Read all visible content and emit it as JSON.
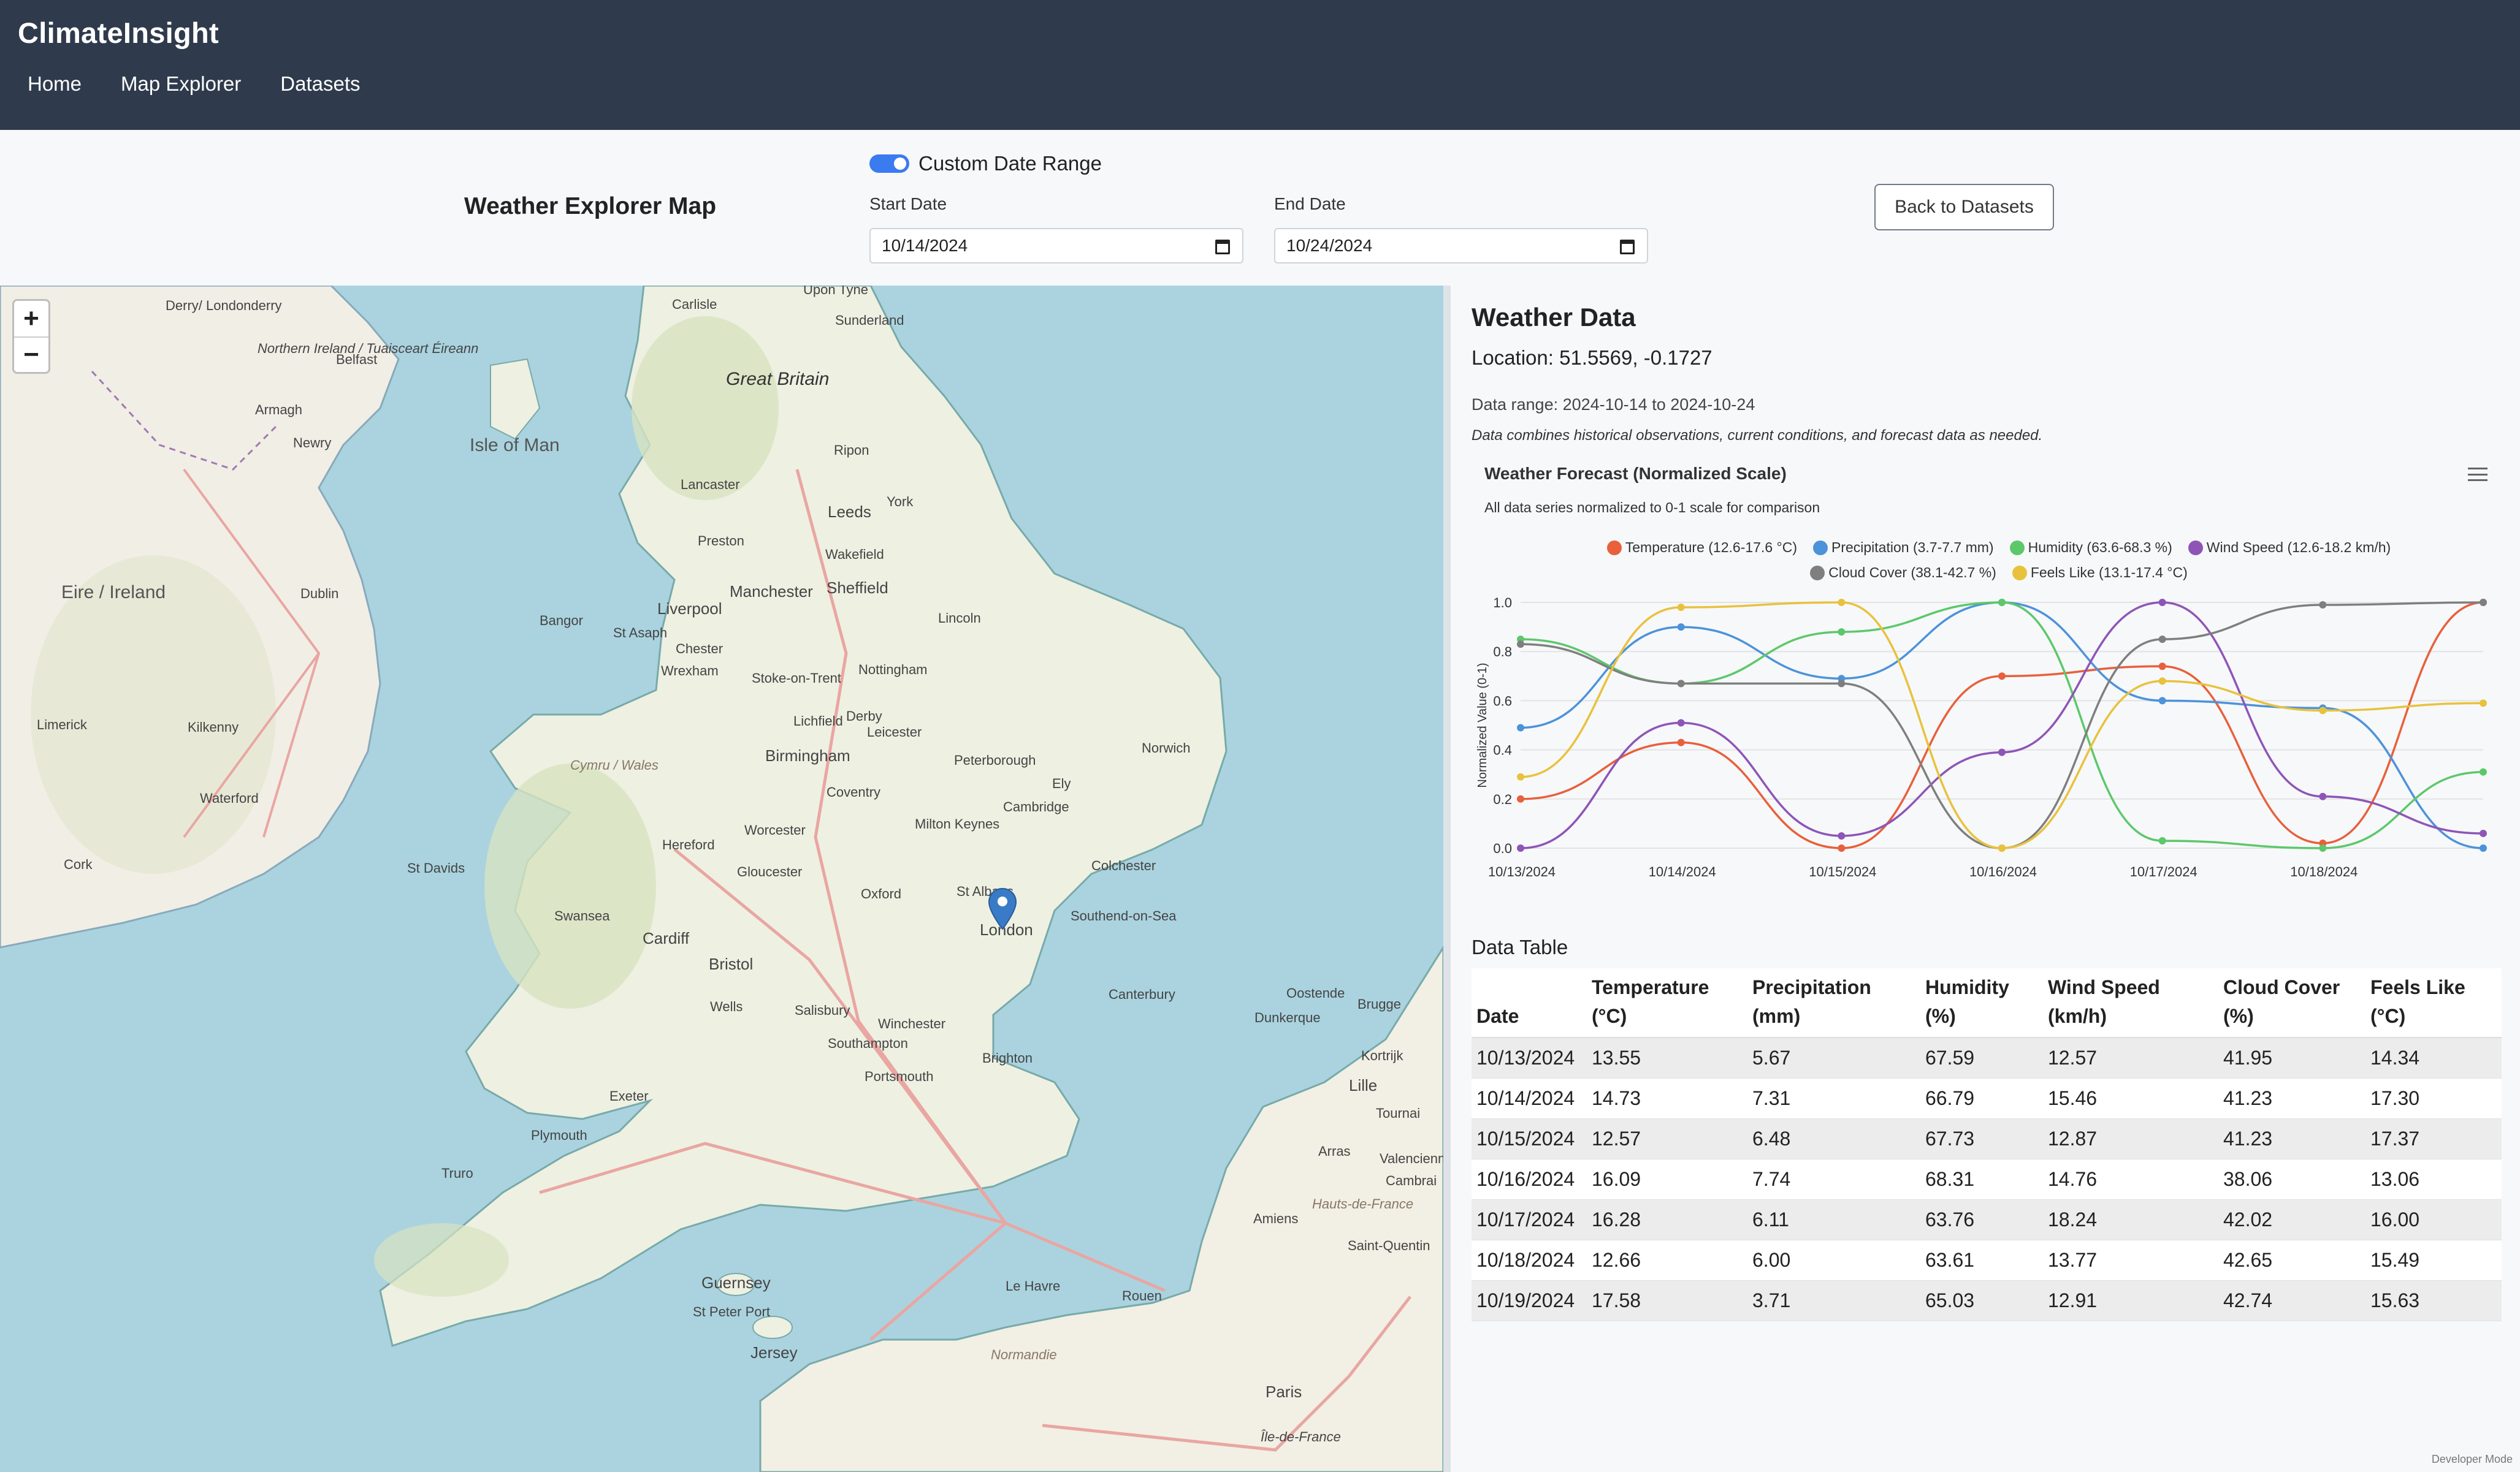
{
  "app": {
    "title": "ClimateInsight"
  },
  "nav": [
    {
      "label": "Home"
    },
    {
      "label": "Map Explorer"
    },
    {
      "label": "Datasets"
    }
  ],
  "toolbar": {
    "page_title": "Weather Explorer Map",
    "toggle_label": "Custom Date Range",
    "toggle_on": true,
    "start_label": "Start Date",
    "start_value": "10/14/2024",
    "end_label": "End Date",
    "end_value": "10/24/2024",
    "back_label": "Back to Datasets"
  },
  "map": {
    "zoom_in": "+",
    "zoom_out": "−",
    "marker_icon": "map-pin-icon",
    "labels": [
      "Great Britain",
      "Isle of Man",
      "Eire / Ireland",
      "Derry/ Londonderry",
      "Northern Ireland / Tuaisceart Éireann",
      "Belfast",
      "Armagh",
      "Newry",
      "Dublin",
      "Limerick",
      "Kilkenny",
      "Waterford",
      "Cork",
      "Carlisle",
      "Upon Tyne",
      "Sunderland",
      "Ripon",
      "York",
      "Leeds",
      "Lancaster",
      "Preston",
      "Wakefield",
      "Sheffield",
      "Manchester",
      "Liverpool",
      "Bangor",
      "St Asaph",
      "Chester",
      "Wrexham",
      "Lincoln",
      "Nottingham",
      "Stoke-on-Trent",
      "Lichfield",
      "Derby",
      "Leicester",
      "Birmingham",
      "Coventry",
      "Peterborough",
      "Norwich",
      "Ely",
      "Cambridge",
      "Worcester",
      "Milton Keynes",
      "Hereford",
      "Gloucester",
      "Oxford",
      "St Albans",
      "Colchester",
      "St Davids",
      "Swansea",
      "Cardiff",
      "Bristol",
      "London",
      "Southend-on-Sea",
      "Wells",
      "Salisbury",
      "Winchester",
      "Canterbury",
      "Southampton",
      "Brighton",
      "Portsmouth",
      "Exeter",
      "Plymouth",
      "Truro",
      "Guernsey",
      "St Peter Port",
      "Jersey",
      "Le Havre",
      "Rouen",
      "Amiens",
      "Arras",
      "Lille",
      "Dunkerque",
      "Oostende",
      "Brugge",
      "Kortrijk",
      "Tournai",
      "Valenciennes",
      "Cambrai",
      "Saint-Quentin",
      "Hauts-de-France",
      "Normandie",
      "Paris",
      "Île-de-France",
      "Cymru / Wales"
    ]
  },
  "panel": {
    "title": "Weather Data",
    "location": "Location: 51.5569, -0.1727",
    "range": "Data range: 2024-10-14 to 2024-10-24",
    "note": "Data combines historical observations, current conditions, and forecast data as needed."
  },
  "chart_menu_icon": "hamburger-menu-icon",
  "chart_data": {
    "type": "line",
    "title": "Weather Forecast (Normalized Scale)",
    "subtitle": "All data series normalized to 0-1 scale for comparison",
    "ylabel": "Normalized Value (0-1)",
    "xlabel": "",
    "ylim": [
      0,
      1
    ],
    "yticks": [
      "0.0",
      "0.2",
      "0.4",
      "0.6",
      "0.8",
      "1.0"
    ],
    "x": [
      "10/13/2024",
      "10/14/2024",
      "10/15/2024",
      "10/16/2024",
      "10/17/2024",
      "10/18/2024",
      "10/19/2024"
    ],
    "xtick_labels": [
      "10/13/2024",
      "10/14/2024",
      "10/15/2024",
      "10/16/2024",
      "10/17/2024",
      "10/18/2024"
    ],
    "grid": true,
    "legend_position": "top",
    "series": [
      {
        "name": "Temperature (12.6-17.6 °C)",
        "color": "#e8603c",
        "values": [
          0.2,
          0.43,
          0.0,
          0.7,
          0.74,
          0.02,
          1.0
        ]
      },
      {
        "name": "Precipitation (3.7-7.7 mm)",
        "color": "#4c93d9",
        "values": [
          0.49,
          0.9,
          0.69,
          1.0,
          0.6,
          0.57,
          0.0
        ]
      },
      {
        "name": "Humidity (63.6-68.3 %)",
        "color": "#5cc86a",
        "values": [
          0.85,
          0.67,
          0.88,
          1.0,
          0.03,
          0.0,
          0.31
        ]
      },
      {
        "name": "Wind Speed (12.6-18.2 km/h)",
        "color": "#8e55b7",
        "values": [
          0.0,
          0.51,
          0.05,
          0.39,
          1.0,
          0.21,
          0.06
        ]
      },
      {
        "name": "Cloud Cover (38.1-42.7 %)",
        "color": "#7f7f7f",
        "values": [
          0.83,
          0.67,
          0.67,
          0.0,
          0.85,
          0.99,
          1.0
        ]
      },
      {
        "name": "Feels Like (13.1-17.4 °C)",
        "color": "#e8c23c",
        "values": [
          0.29,
          0.98,
          1.0,
          0.0,
          0.68,
          0.56,
          0.59
        ]
      }
    ]
  },
  "table": {
    "title": "Data Table",
    "headers": [
      "Date",
      "Temperature (°C)",
      "Precipitation (mm)",
      "Humidity (%)",
      "Wind Speed (km/h)",
      "Cloud Cover (%)",
      "Feels Like (°C)"
    ],
    "header_lines": [
      [
        "Date"
      ],
      [
        "Temperature",
        "(°C)"
      ],
      [
        "Precipitation",
        "(mm)"
      ],
      [
        "Humidity",
        "(%)"
      ],
      [
        "Wind Speed",
        "(km/h)"
      ],
      [
        "Cloud Cover",
        "(%)"
      ],
      [
        "Feels Like",
        "(°C)"
      ]
    ],
    "rows": [
      [
        "10/13/2024",
        "13.55",
        "5.67",
        "67.59",
        "12.57",
        "41.95",
        "14.34"
      ],
      [
        "10/14/2024",
        "14.73",
        "7.31",
        "66.79",
        "15.46",
        "41.23",
        "17.30"
      ],
      [
        "10/15/2024",
        "12.57",
        "6.48",
        "67.73",
        "12.87",
        "41.23",
        "17.37"
      ],
      [
        "10/16/2024",
        "16.09",
        "7.74",
        "68.31",
        "14.76",
        "38.06",
        "13.06"
      ],
      [
        "10/17/2024",
        "16.28",
        "6.11",
        "63.76",
        "18.24",
        "42.02",
        "16.00"
      ],
      [
        "10/18/2024",
        "12.66",
        "6.00",
        "63.61",
        "13.77",
        "42.65",
        "15.49"
      ],
      [
        "10/19/2024",
        "17.58",
        "3.71",
        "65.03",
        "12.91",
        "42.74",
        "15.63"
      ]
    ]
  },
  "footer": {
    "dev_mode": "Developer Mode"
  }
}
